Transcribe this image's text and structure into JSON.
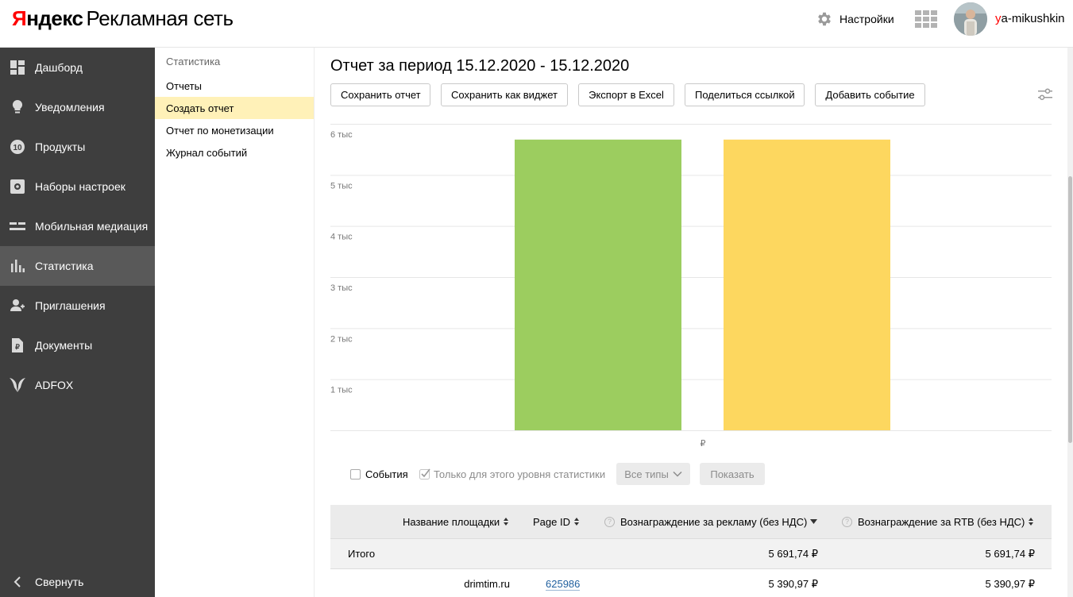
{
  "header": {
    "logo_part1": "Я",
    "logo_part2": "ндекс",
    "logo_product": "Рекламная сеть",
    "settings_label": "Настройки",
    "user_first": "y",
    "user_rest": "a-mikushkin"
  },
  "sidebar": {
    "items": [
      {
        "label": "Дашборд",
        "icon": "dashboard-icon"
      },
      {
        "label": "Уведомления",
        "icon": "bulb-icon"
      },
      {
        "label": "Продукты",
        "icon": "products-icon"
      },
      {
        "label": "Наборы настроек",
        "icon": "settings-set-icon"
      },
      {
        "label": "Мобильная медиация",
        "icon": "mediation-icon"
      },
      {
        "label": "Статистика",
        "icon": "stats-icon"
      },
      {
        "label": "Приглашения",
        "icon": "invite-icon"
      },
      {
        "label": "Документы",
        "icon": "document-icon"
      },
      {
        "label": "ADFOX",
        "icon": "adfox-icon"
      }
    ],
    "products_badge": "10",
    "active_index": 5,
    "collapse_label": "Свернуть"
  },
  "submenu": {
    "title": "Статистика",
    "items": [
      "Отчеты",
      "Создать отчет",
      "Отчет по монетизации",
      "Журнал событий"
    ],
    "active_index": 1
  },
  "report": {
    "title": "Отчет за период 15.12.2020 - 15.12.2020",
    "buttons": [
      "Сохранить отчет",
      "Сохранить как виджет",
      "Экспорт в Excel",
      "Поделиться ссылкой",
      "Добавить событие"
    ]
  },
  "chart_data": {
    "type": "bar",
    "categories": [
      "Вознаграждение за рекламу (без НДС)",
      "Вознаграждение за RTB (без НДС)"
    ],
    "values": [
      5691.74,
      5691.74
    ],
    "colors": [
      "#9ccd5f",
      "#fdd75f"
    ],
    "yticks": [
      1000,
      2000,
      3000,
      4000,
      5000,
      6000
    ],
    "ytick_labels": [
      "1 тыс",
      "2 тыс",
      "3 тыс",
      "4 тыс",
      "5 тыс",
      "6 тыс"
    ],
    "ylim": [
      0,
      6000
    ],
    "xlabel": "₽",
    "grid": true
  },
  "controls": {
    "events_label": "События",
    "level_label": "Только для этого уровня статистики",
    "types_label": "Все типы",
    "show_label": "Показать"
  },
  "table": {
    "headers": {
      "site": "Название площадки",
      "page_id": "Page ID",
      "reward_ads": "Вознаграждение за рекламу (без НДС)",
      "reward_rtb": "Вознаграждение за RTB (без НДС)"
    },
    "total": {
      "label": "Итого",
      "reward_ads": "5 691,74 ₽",
      "reward_rtb": "5 691,74 ₽"
    },
    "rows": [
      {
        "site": "drimtim.ru",
        "page_id": "625986",
        "reward_ads": "5 390,97 ₽",
        "reward_rtb": "5 390,97 ₽"
      }
    ]
  }
}
